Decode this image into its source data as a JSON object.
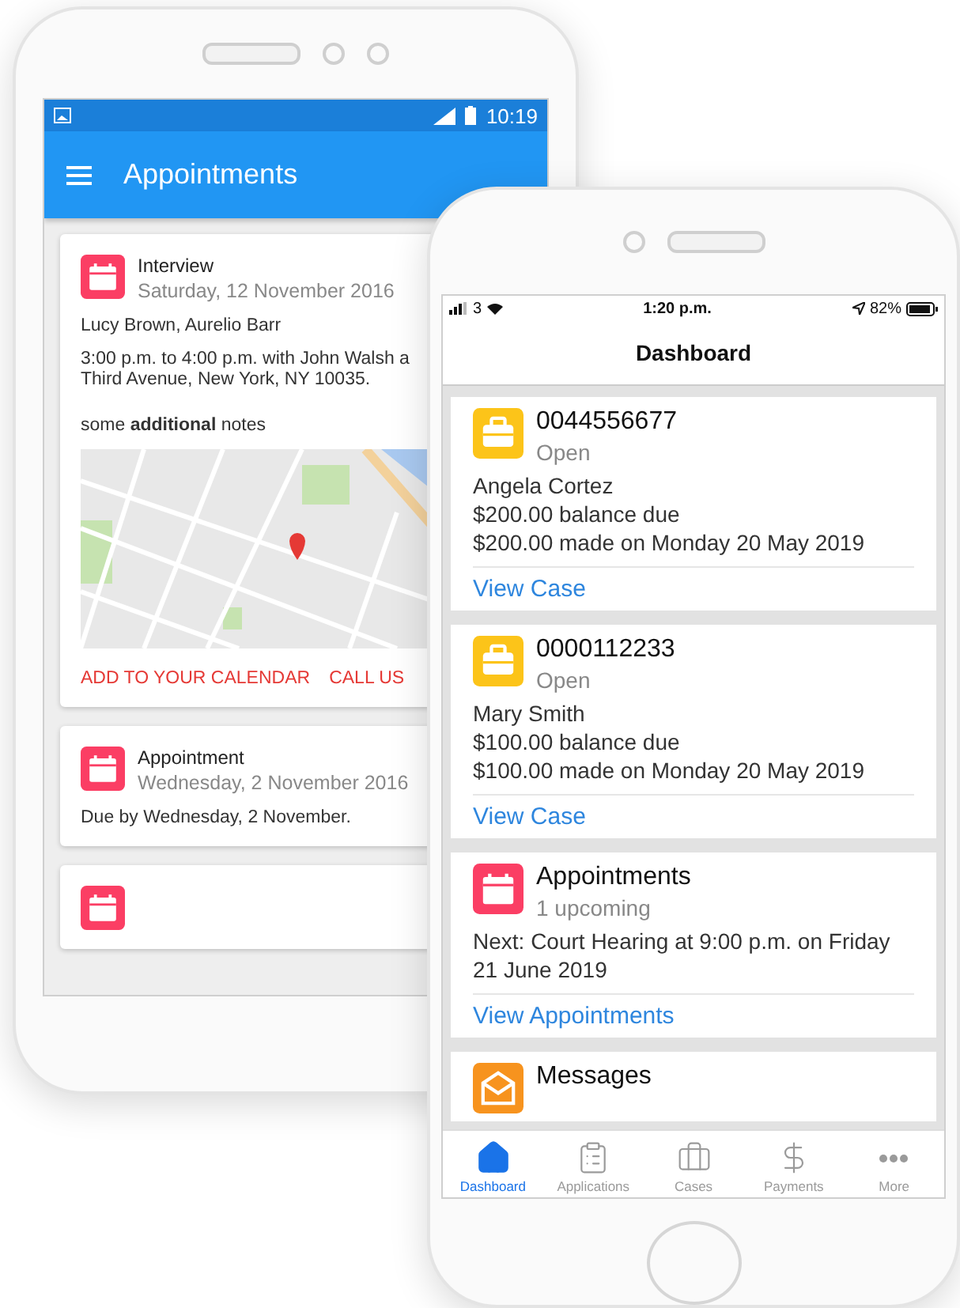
{
  "android_phone": {
    "status_bar": {
      "time": "10:19"
    },
    "app_bar": {
      "title": "Appointments"
    },
    "cards": [
      {
        "kind": "detail",
        "title": "Interview",
        "date": "Saturday, 12 November 2016",
        "lines": [
          "Lucy Brown, Aurelio Barr"
        ],
        "address": [
          "3:00 p.m. to 4:00 p.m. with John Walsh a",
          "Third Avenue, New York, NY 10035."
        ],
        "notes": "some **additional** notes",
        "actions": [
          "ADD TO YOUR CALENDAR",
          "CALL US"
        ]
      },
      {
        "kind": "simple",
        "title": "Appointment",
        "date": "Wednesday, 2 November 2016",
        "lines": [
          "Due by Wednesday, 2 November."
        ]
      },
      {
        "kind": "stub"
      }
    ]
  },
  "ios_phone": {
    "status_bar": {
      "carrier": "3",
      "time": "1:20 p.m.",
      "battery": "82%"
    },
    "title": "Dashboard",
    "cards": [
      {
        "kind": "case",
        "title": "0044556677",
        "subtitle": "Open",
        "lines": [
          "Angela Cortez",
          "$200.00 balance due",
          "$200.00 made on Monday 20 May 2019"
        ],
        "link": "View Case"
      },
      {
        "kind": "case",
        "title": "0000112233",
        "subtitle": "Open",
        "lines": [
          "Mary Smith",
          "$100.00 balance due",
          "$100.00 made on Monday 20 May 2019"
        ],
        "link": "View Case"
      },
      {
        "kind": "appointments",
        "title": "Appointments",
        "subtitle": "1 upcoming",
        "lines": [
          "Next: Court Hearing at 9:00 p.m. on Friday 21 June 2019"
        ],
        "link": "View Appointments"
      },
      {
        "kind": "messages",
        "title": "Messages"
      }
    ],
    "tab_bar": [
      {
        "label": "Dashboard",
        "selected": true
      },
      {
        "label": "Applications",
        "selected": false
      },
      {
        "label": "Cases",
        "selected": false
      },
      {
        "label": "Payments",
        "selected": false
      },
      {
        "label": "More",
        "selected": false
      }
    ]
  }
}
